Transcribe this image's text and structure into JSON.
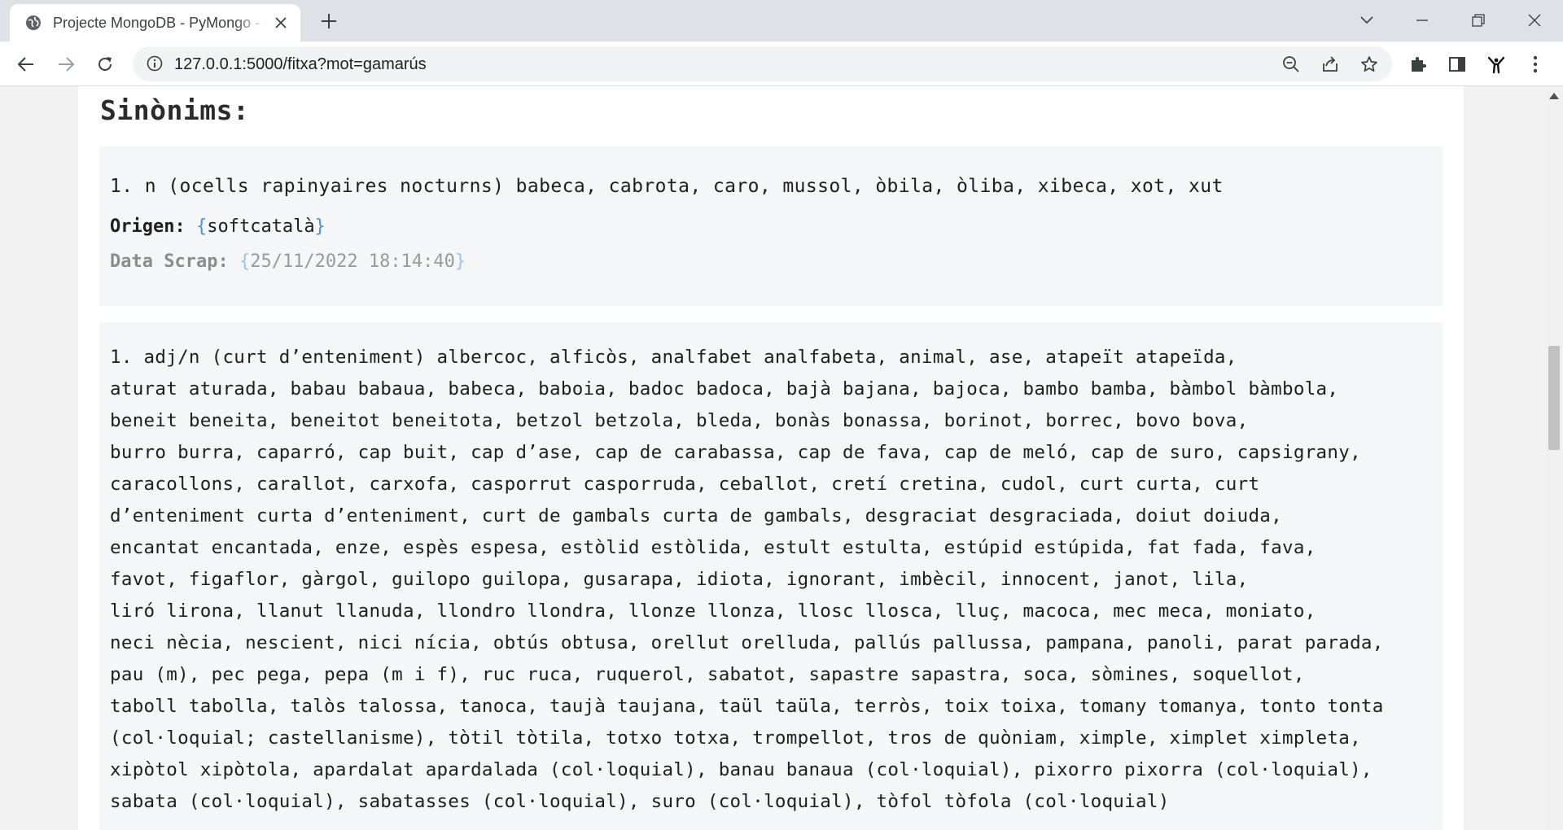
{
  "browser": {
    "tab_title": "Projecte MongoDB - PyMongo - Fitxa del mot",
    "url": "127.0.0.1:5000/fitxa?mot=gamarús",
    "icons": {
      "favicon": "globe-icon",
      "tab_close": "close-icon",
      "new_tab": "plus-icon",
      "tab_search": "chevron-down-icon",
      "minimize": "minimize-icon",
      "restore": "restore-icon",
      "close_window": "close-icon",
      "back": "arrow-left-icon",
      "forward": "arrow-right-icon",
      "reload": "reload-icon",
      "site_info": "info-icon",
      "zoom": "zoom-out-icon",
      "share": "share-icon",
      "bookmark": "star-icon",
      "extensions": "puzzle-icon",
      "side_panel": "side-panel-icon",
      "profile": "avatar",
      "menu": "kebab-menu-icon"
    }
  },
  "page": {
    "section_title": "Sinònims:",
    "entries": [
      {
        "text": "1. n (ocells rapinyaires nocturns) babeca, cabrota, caro, mussol, òbila, òliba, xibeca, xot, xut",
        "origen_label": "Origen:",
        "origen_value": "softcatalà",
        "scrap_label": "Data Scrap:",
        "scrap_value": "25/11/2022 18:14:40"
      },
      {
        "text": "1. adj/n (curt d’enteniment) albercoc, alficòs, analfabet analfabeta, animal, ase, atapeït atapeïda,\naturat aturada, babau babaua, babeca, baboia, badoc badoca, bajà bajana, bajoca, bambo bamba, bàmbol bàmbola,\nbeneit beneita, beneitot beneitota, betzol betzola, bleda, bonàs bonassa, borinot, borrec, bovo bova,\nburro burra, caparró, cap buit, cap d’ase, cap de carabassa, cap de fava, cap de meló, cap de suro, capsigrany,\ncaracollons, carallot, carxofa, casporrut casporruda, ceballot, cretí cretina, cudol, curt curta, curt\nd’enteniment curta d’enteniment, curt de gambals curta de gambals, desgraciat desgraciada, doiut doiuda,\nencantat encantada, enze, espès espesa, estòlid estòlida, estult estulta, estúpid estúpida, fat fada, fava,\nfavot, figaflor, gàrgol, guilopo guilopa, gusarapa, idiota, ignorant, imbècil, innocent, janot, lila,\nliró lirona, llanut llanuda, llondro llondra, llonze llonza, llosc llosca, lluç, macoca, mec meca, moniato,\nneci nècia, nescient, nici nícia, obtús obtusa, orellut orelluda, pallús pallussa, pampana, panoli, parat parada,\npau (m), pec pega, pepa (m i f), ruc ruca, ruquerol, sabatot, sapastre sapastra, soca, sòmines, soquellot,\ntaboll tabolla, talòs talossa, tanoca, taujà taujana, taül taüla, terròs, toix toixa, tomany tomanya, tonto tonta\n(col·loquial; castellanisme), tòtil tòtila, totxo totxa, trompellot, tros de quòniam, ximple, ximplet ximpleta,\nxipòtol xipòtola, apardalat apardalada (col·loquial), banau banaua (col·loquial), pixorro pixorra (col·loquial),\nsabata (col·loquial), sabatasses (col·loquial), suro (col·loquial), tòfol tòfola (col·loquial)"
      }
    ]
  }
}
